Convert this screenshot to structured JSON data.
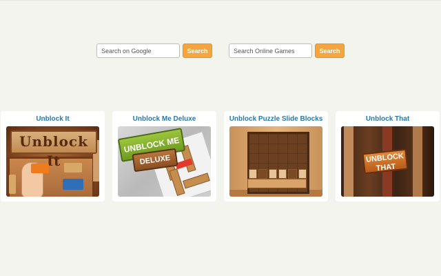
{
  "search": {
    "google": {
      "placeholder": "Search on Google",
      "button_label": "Search"
    },
    "games": {
      "placeholder": "Search Online Games",
      "button_label": "Search"
    }
  },
  "cards": [
    {
      "title": "Unblock It",
      "art_text": "Unblock It"
    },
    {
      "title": "Unblock Me Deluxe",
      "art_text_1": "UNBLOCK ME",
      "art_text_2": "DELUXE"
    },
    {
      "title": "Unblock Puzzle Slide Blocks"
    },
    {
      "title": "Unblock That",
      "art_text_1": "UNBLOCK",
      "art_text_2": "THAT"
    }
  ],
  "colors": {
    "accent": "#f4a53b",
    "title": "#2a78a8",
    "background": "#f4f4ee"
  }
}
